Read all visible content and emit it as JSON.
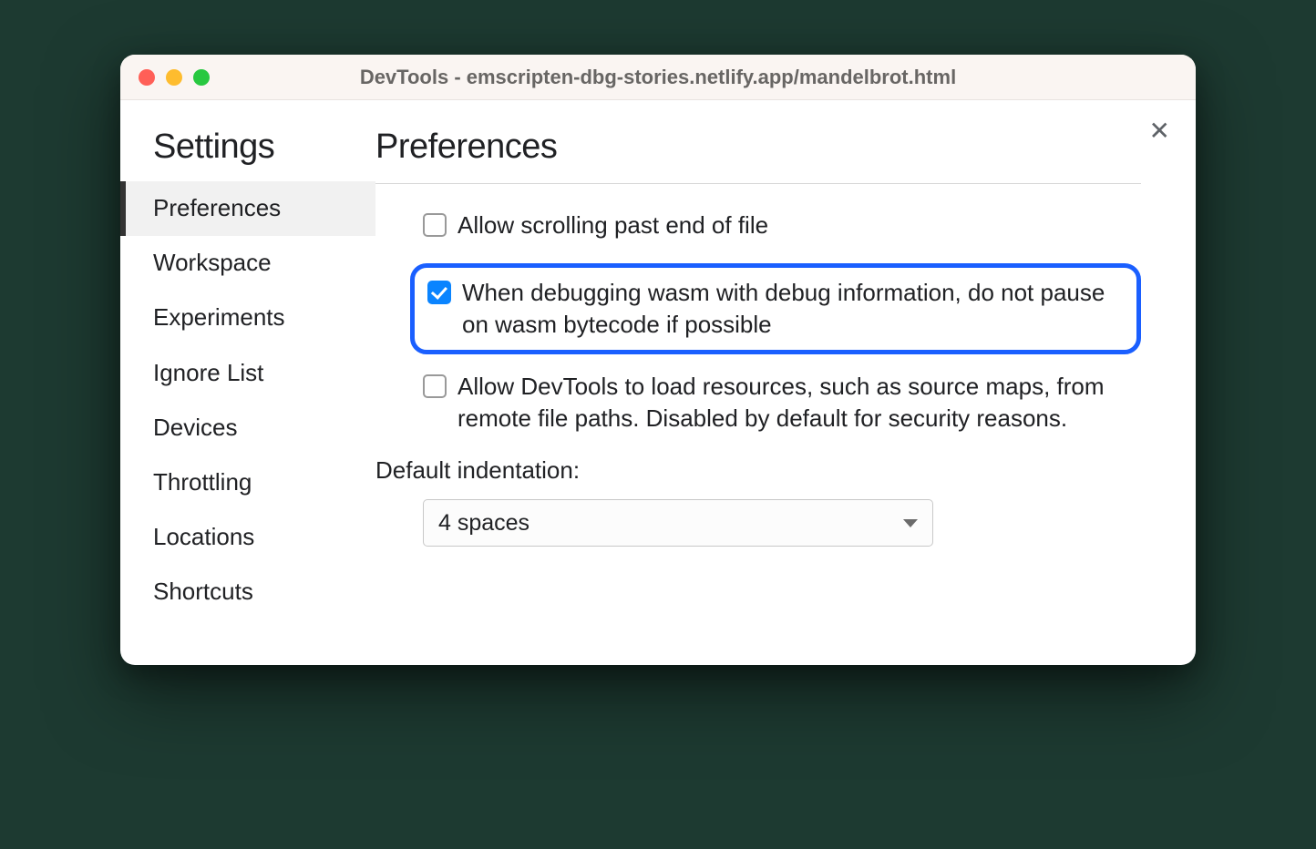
{
  "window": {
    "title": "DevTools - emscripten-dbg-stories.netlify.app/mandelbrot.html"
  },
  "sidebar": {
    "title": "Settings",
    "items": [
      {
        "label": "Preferences",
        "active": true
      },
      {
        "label": "Workspace",
        "active": false
      },
      {
        "label": "Experiments",
        "active": false
      },
      {
        "label": "Ignore List",
        "active": false
      },
      {
        "label": "Devices",
        "active": false
      },
      {
        "label": "Throttling",
        "active": false
      },
      {
        "label": "Locations",
        "active": false
      },
      {
        "label": "Shortcuts",
        "active": false
      }
    ]
  },
  "main": {
    "title": "Preferences",
    "options": [
      {
        "label": "Allow scrolling past end of file",
        "checked": false,
        "highlighted": false
      },
      {
        "label": "When debugging wasm with debug information, do not pause on wasm bytecode if possible",
        "checked": true,
        "highlighted": true
      },
      {
        "label": "Allow DevTools to load resources, such as source maps, from remote file paths. Disabled by default for security reasons.",
        "checked": false,
        "highlighted": false
      }
    ],
    "indentation": {
      "label": "Default indentation:",
      "value": "4 spaces"
    }
  }
}
